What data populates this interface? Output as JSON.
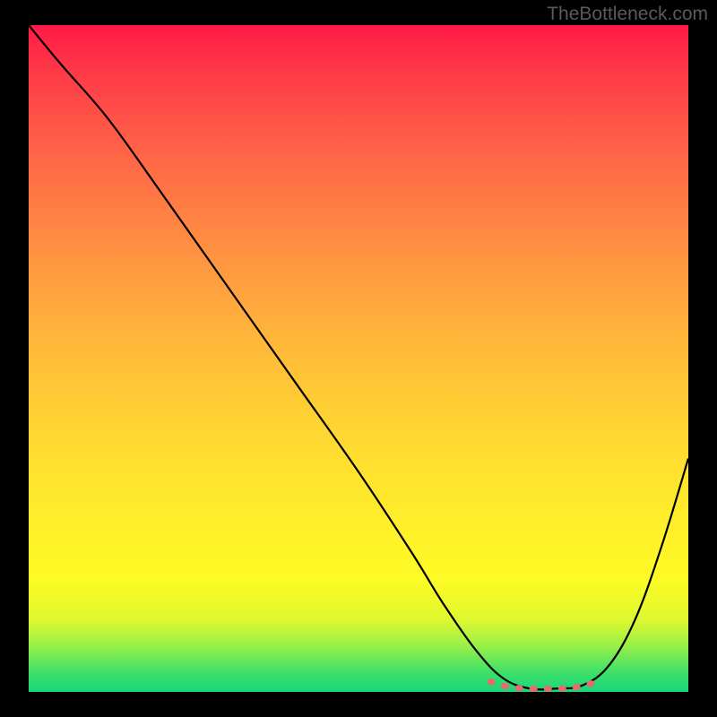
{
  "watermark": "TheBottleneck.com",
  "colors": {
    "background": "#000000",
    "gradient_top": "#ff1a46",
    "gradient_bottom": "#18d67a",
    "curve": "#000000",
    "valley_marker": "#e86a6a"
  },
  "chart_data": {
    "type": "line",
    "title": "",
    "xlabel": "",
    "ylabel": "",
    "xlim": [
      0,
      100
    ],
    "ylim": [
      0,
      100
    ],
    "grid": false,
    "legend": false,
    "series": [
      {
        "name": "bottleneck-curve",
        "x": [
          0,
          5,
          12,
          20,
          30,
          40,
          50,
          58,
          63,
          68,
          72,
          76,
          80,
          84,
          88,
          92,
          96,
          100
        ],
        "values": [
          100,
          94,
          86,
          75,
          61,
          47,
          33,
          21,
          13,
          6,
          2,
          0.5,
          0.5,
          1,
          4,
          11,
          22,
          35
        ]
      }
    ],
    "annotations": [
      {
        "name": "valley-floor-marker",
        "style": "dashed",
        "color": "#e86a6a",
        "x_range": [
          70,
          86
        ],
        "y_approx": 1
      }
    ]
  }
}
